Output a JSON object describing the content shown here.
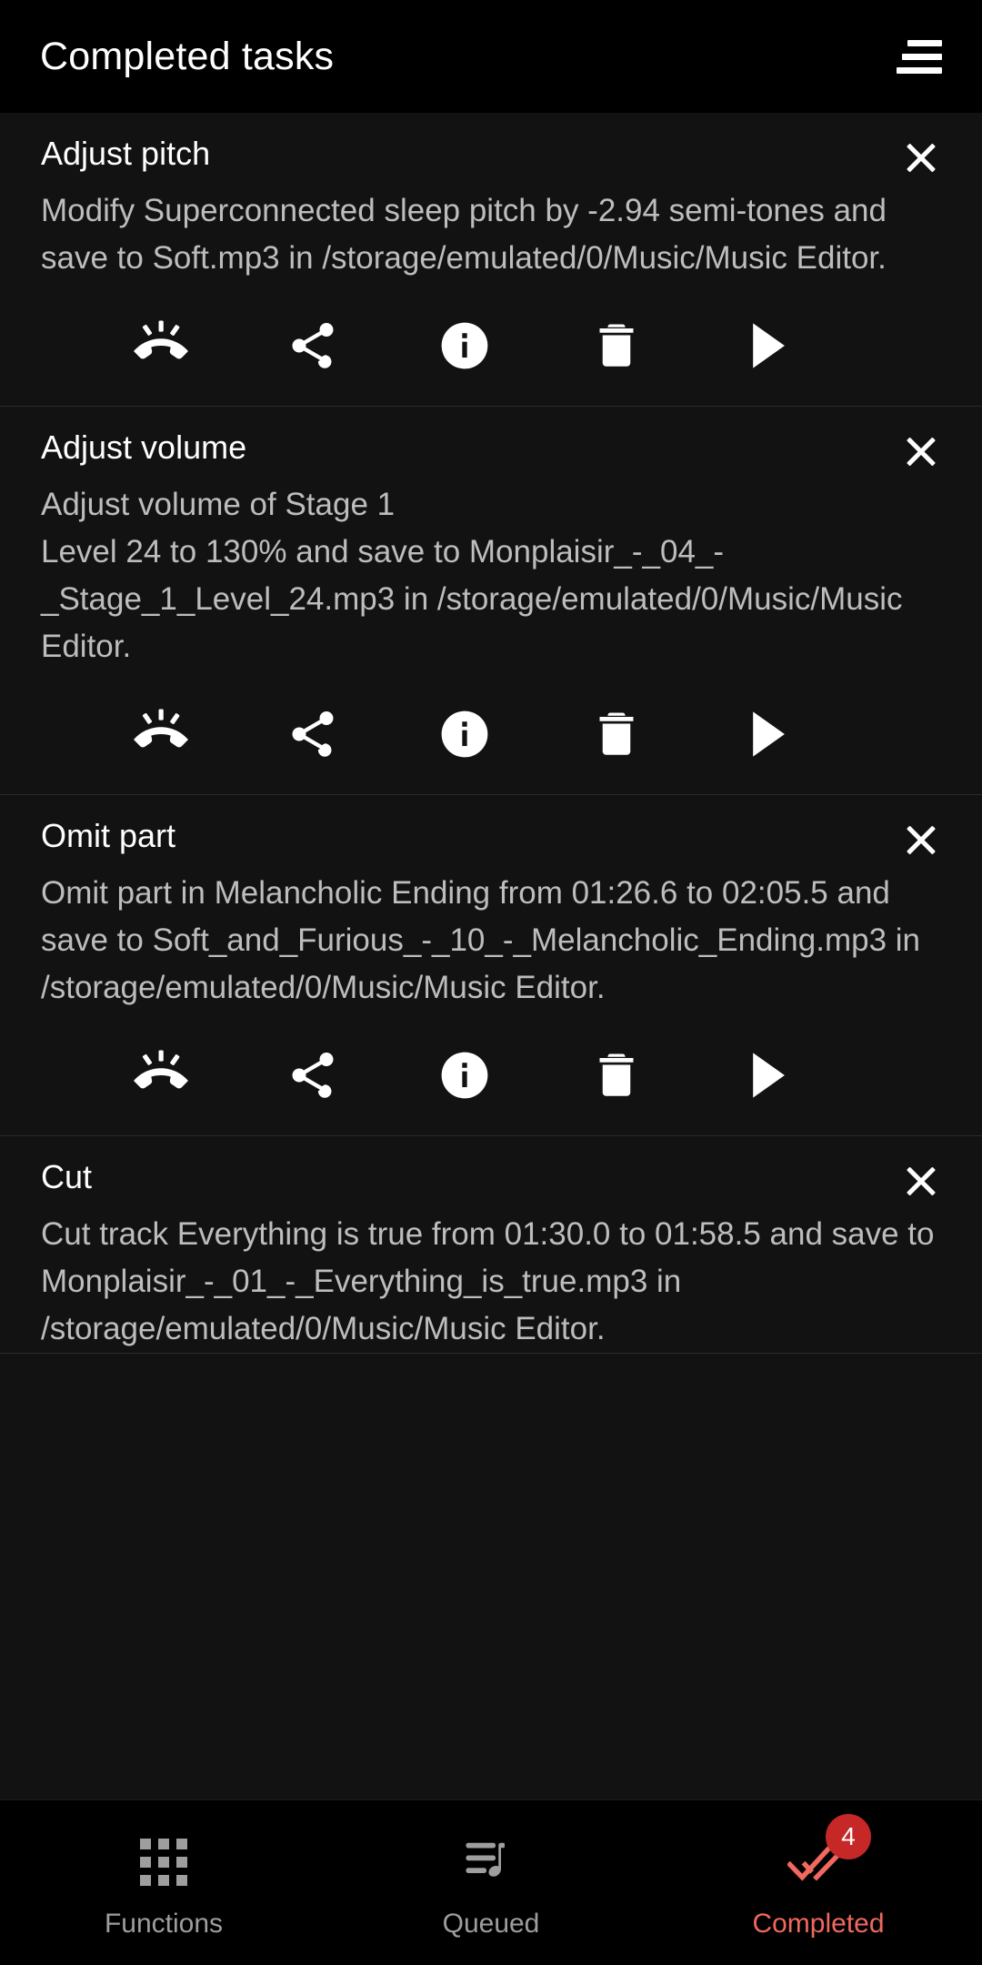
{
  "header": {
    "title": "Completed tasks",
    "sort_icon": "sort-icon"
  },
  "tasks": [
    {
      "title": "Adjust pitch",
      "description": "Modify Superconnected sleep pitch by -2.94 semi-tones and save to Soft.mp3 in /storage/emulated/0/Music/Music Editor.",
      "close_label": "×",
      "actions": [
        {
          "name": "ringtone-icon",
          "label": "Set as ringtone"
        },
        {
          "name": "share-icon",
          "label": "Share"
        },
        {
          "name": "info-icon",
          "label": "Info"
        },
        {
          "name": "delete-icon",
          "label": "Delete"
        },
        {
          "name": "play-icon",
          "label": "Play"
        }
      ]
    },
    {
      "title": "Adjust volume",
      "description": "Adjust volume of Stage 1\nLevel 24 to 130% and save to Monplaisir_-_04_-_Stage_1_Level_24.mp3 in /storage/emulated/0/Music/Music Editor.",
      "close_label": "×",
      "actions": [
        {
          "name": "ringtone-icon",
          "label": "Set as ringtone"
        },
        {
          "name": "share-icon",
          "label": "Share"
        },
        {
          "name": "info-icon",
          "label": "Info"
        },
        {
          "name": "delete-icon",
          "label": "Delete"
        },
        {
          "name": "play-icon",
          "label": "Play"
        }
      ]
    },
    {
      "title": "Omit part",
      "description": "Omit part in Melancholic Ending from 01:26.6 to 02:05.5 and save to Soft_and_Furious_-_10_-_Melancholic_Ending.mp3 in /storage/emulated/0/Music/Music Editor.",
      "close_label": "×",
      "actions": [
        {
          "name": "ringtone-icon",
          "label": "Set as ringtone"
        },
        {
          "name": "share-icon",
          "label": "Share"
        },
        {
          "name": "info-icon",
          "label": "Info"
        },
        {
          "name": "delete-icon",
          "label": "Delete"
        },
        {
          "name": "play-icon",
          "label": "Play"
        }
      ]
    },
    {
      "title": "Cut",
      "description": "Cut track Everything is true from 01:30.0 to 01:58.5 and save to Monplaisir_-_01_-_Everything_is_true.mp3 in /storage/emulated/0/Music/Music Editor.",
      "close_label": "×",
      "actions": []
    }
  ],
  "bottom_nav": {
    "items": [
      {
        "label": "Functions",
        "icon": "grid-icon",
        "active": false
      },
      {
        "label": "Queued",
        "icon": "queue-music-icon",
        "active": false
      },
      {
        "label": "Completed",
        "icon": "done-all-icon",
        "active": true,
        "badge": "4"
      }
    ]
  },
  "colors": {
    "background": "#000000",
    "card": "#121212",
    "divider": "#2a2a2a",
    "title_text": "#ffffff",
    "body_text": "#bdbdbd",
    "nav_inactive": "#9e9e9e",
    "accent": "#f0685f",
    "badge_background": "#c62828",
    "badge_text": "#ffffff"
  }
}
